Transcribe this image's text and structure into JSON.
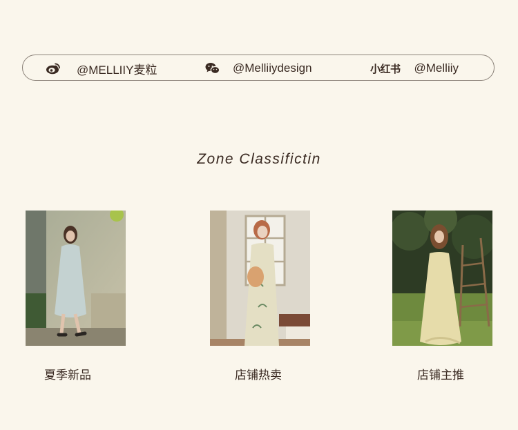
{
  "social": {
    "weibo": {
      "icon": "weibo-icon",
      "handle": "@MELLIIY麦粒"
    },
    "wechat": {
      "icon": "wechat-icon",
      "handle": "@Melliiydesign"
    },
    "xiaohongshu": {
      "logo": "小红书",
      "handle": "@Melliiy"
    }
  },
  "zone": {
    "title": "Zone Classifictin"
  },
  "categories": [
    {
      "label": "夏季新品",
      "photo": "woman-in-pale-blue-dress-photo"
    },
    {
      "label": "店铺热卖",
      "photo": "woman-in-bamboo-print-qipao-photo"
    },
    {
      "label": "店铺主推",
      "photo": "woman-in-yellow-slip-dress-photo"
    }
  ],
  "colors": {
    "background": "#faf6ec",
    "text": "#3a2a22",
    "border": "#8a8178"
  }
}
